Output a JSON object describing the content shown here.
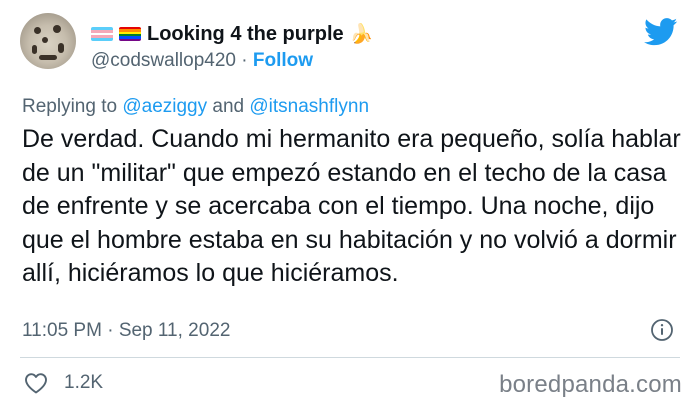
{
  "author": {
    "display_name": "Looking 4 the purple",
    "handle": "@codswallop420",
    "separator": "·",
    "follow_label": "Follow",
    "banana_emoji": "🍌"
  },
  "reply": {
    "prefix": "Replying to",
    "mention_1": "@aeziggy",
    "conjunction": "and",
    "mention_2": "@itsnashflynn"
  },
  "tweet": {
    "text": "De verdad. Cuando mi hermanito era pequeño, solía hablar de un \"militar\" que empezó estando en el techo de la casa de enfrente y se acercaba con el tiempo. Una noche, dijo que el hombre estaba en su habitación y no volvió a dormir allí, hiciéramos lo que hiciéramos."
  },
  "meta": {
    "time": "11:05 PM",
    "separator": "·",
    "date": "Sep 11, 2022"
  },
  "stats": {
    "likes": "1.2K"
  },
  "watermark": "boredpanda.com",
  "colors": {
    "accent": "#1d9bf0",
    "secondary_text": "#536471",
    "primary_text": "#0f1419"
  },
  "icons": {
    "avatar": "avatar-image",
    "trans_flag": "transgender-flag-icon",
    "pride_flag": "rainbow-flag-icon",
    "brand": "twitter-bird-icon",
    "info": "info-icon",
    "like": "heart-icon"
  }
}
